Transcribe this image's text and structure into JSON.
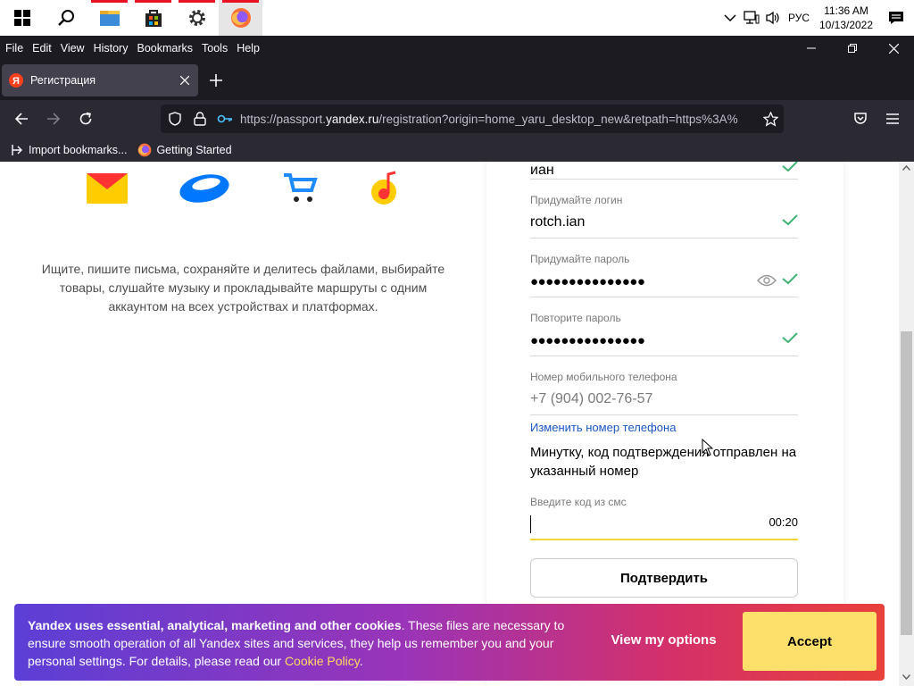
{
  "taskbar": {
    "tray": {
      "language": "РУС",
      "time": "11:36 AM",
      "date": "10/13/2022"
    }
  },
  "menubar": {
    "items": [
      "File",
      "Edit",
      "View",
      "History",
      "Bookmarks",
      "Tools",
      "Help"
    ]
  },
  "tab": {
    "title": "Регистрация"
  },
  "urlbar": {
    "prefix": "https://passport.",
    "domain": "yandex.ru",
    "rest": "/registration?origin=home_yaru_desktop_new&retpath=https%3A%"
  },
  "bookmarks": {
    "import": "Import bookmarks...",
    "getting_started": "Getting Started"
  },
  "promo": {
    "text": "Ищите, пишите письма, сохраняйте и делитесь файлами, выбирайте товары, слушайте музыку и прокладывайте маршруты с одним аккаунтом на всех устройствах и платформах."
  },
  "form": {
    "surname_value": "иан",
    "login_label": "Придумайте логин",
    "login_value": "rotch.ian",
    "password_label": "Придумайте пароль",
    "password_value": "●●●●●●●●●●●●●●●",
    "repeat_label": "Повторите пароль",
    "repeat_value": "●●●●●●●●●●●●●●●",
    "phone_label": "Номер мобильного телефона",
    "phone_value": "+7 (904) 002-76-57",
    "change_phone": "Изменить номер телефона",
    "sent_notice": "Минутку, код подтверждения отправлен на указанный номер",
    "code_label": "Введите код из смс",
    "timer": "00:20",
    "confirm": "Подтвердить"
  },
  "cookie": {
    "bold": "Yandex uses essential, analytical, marketing and other cookies",
    "text": ". These files are necessary to ensure smooth operation of all Yandex sites and services, they help us remember you and your personal settings. For details, please read our ",
    "link": "Cookie Policy",
    "end": ".",
    "options": "View my options",
    "accept": "Accept"
  }
}
